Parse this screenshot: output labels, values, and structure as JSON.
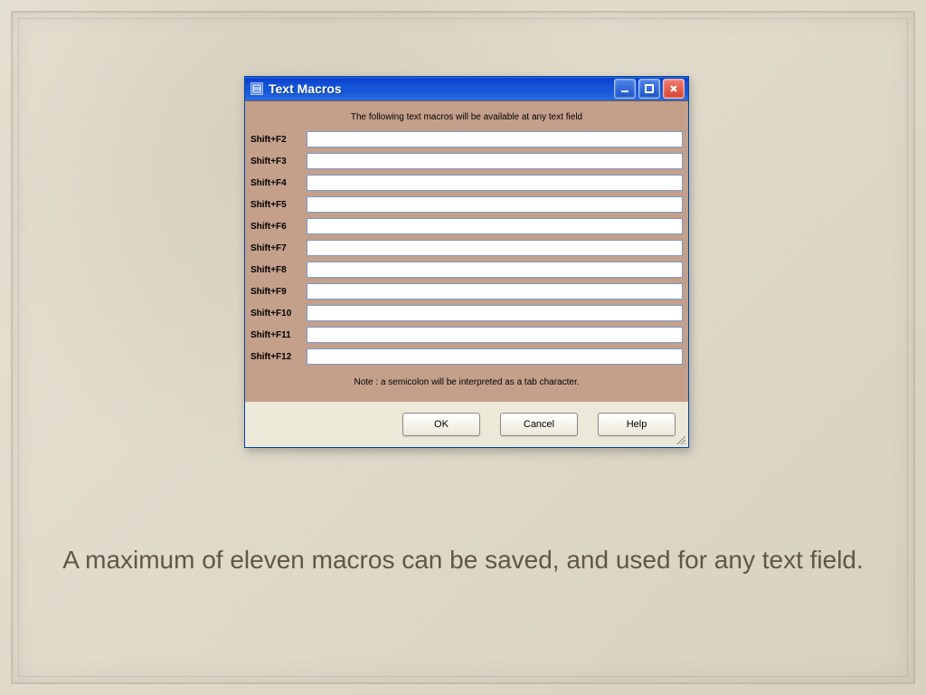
{
  "window": {
    "title": "Text Macros",
    "description": "The following text macros will be available at any text field",
    "note": "Note :  a semicolon will be interpreted as a tab character.",
    "buttons": {
      "ok": "OK",
      "cancel": "Cancel",
      "help": "Help"
    },
    "rows": [
      {
        "label": "Shift+F2",
        "value": ""
      },
      {
        "label": "Shift+F3",
        "value": ""
      },
      {
        "label": "Shift+F4",
        "value": ""
      },
      {
        "label": "Shift+F5",
        "value": ""
      },
      {
        "label": "Shift+F6",
        "value": ""
      },
      {
        "label": "Shift+F7",
        "value": ""
      },
      {
        "label": "Shift+F8",
        "value": ""
      },
      {
        "label": "Shift+F9",
        "value": ""
      },
      {
        "label": "Shift+F10",
        "value": ""
      },
      {
        "label": "Shift+F11",
        "value": ""
      },
      {
        "label": "Shift+F12",
        "value": ""
      }
    ]
  },
  "caption": "A maximum of eleven macros can be saved, and used for any text field."
}
